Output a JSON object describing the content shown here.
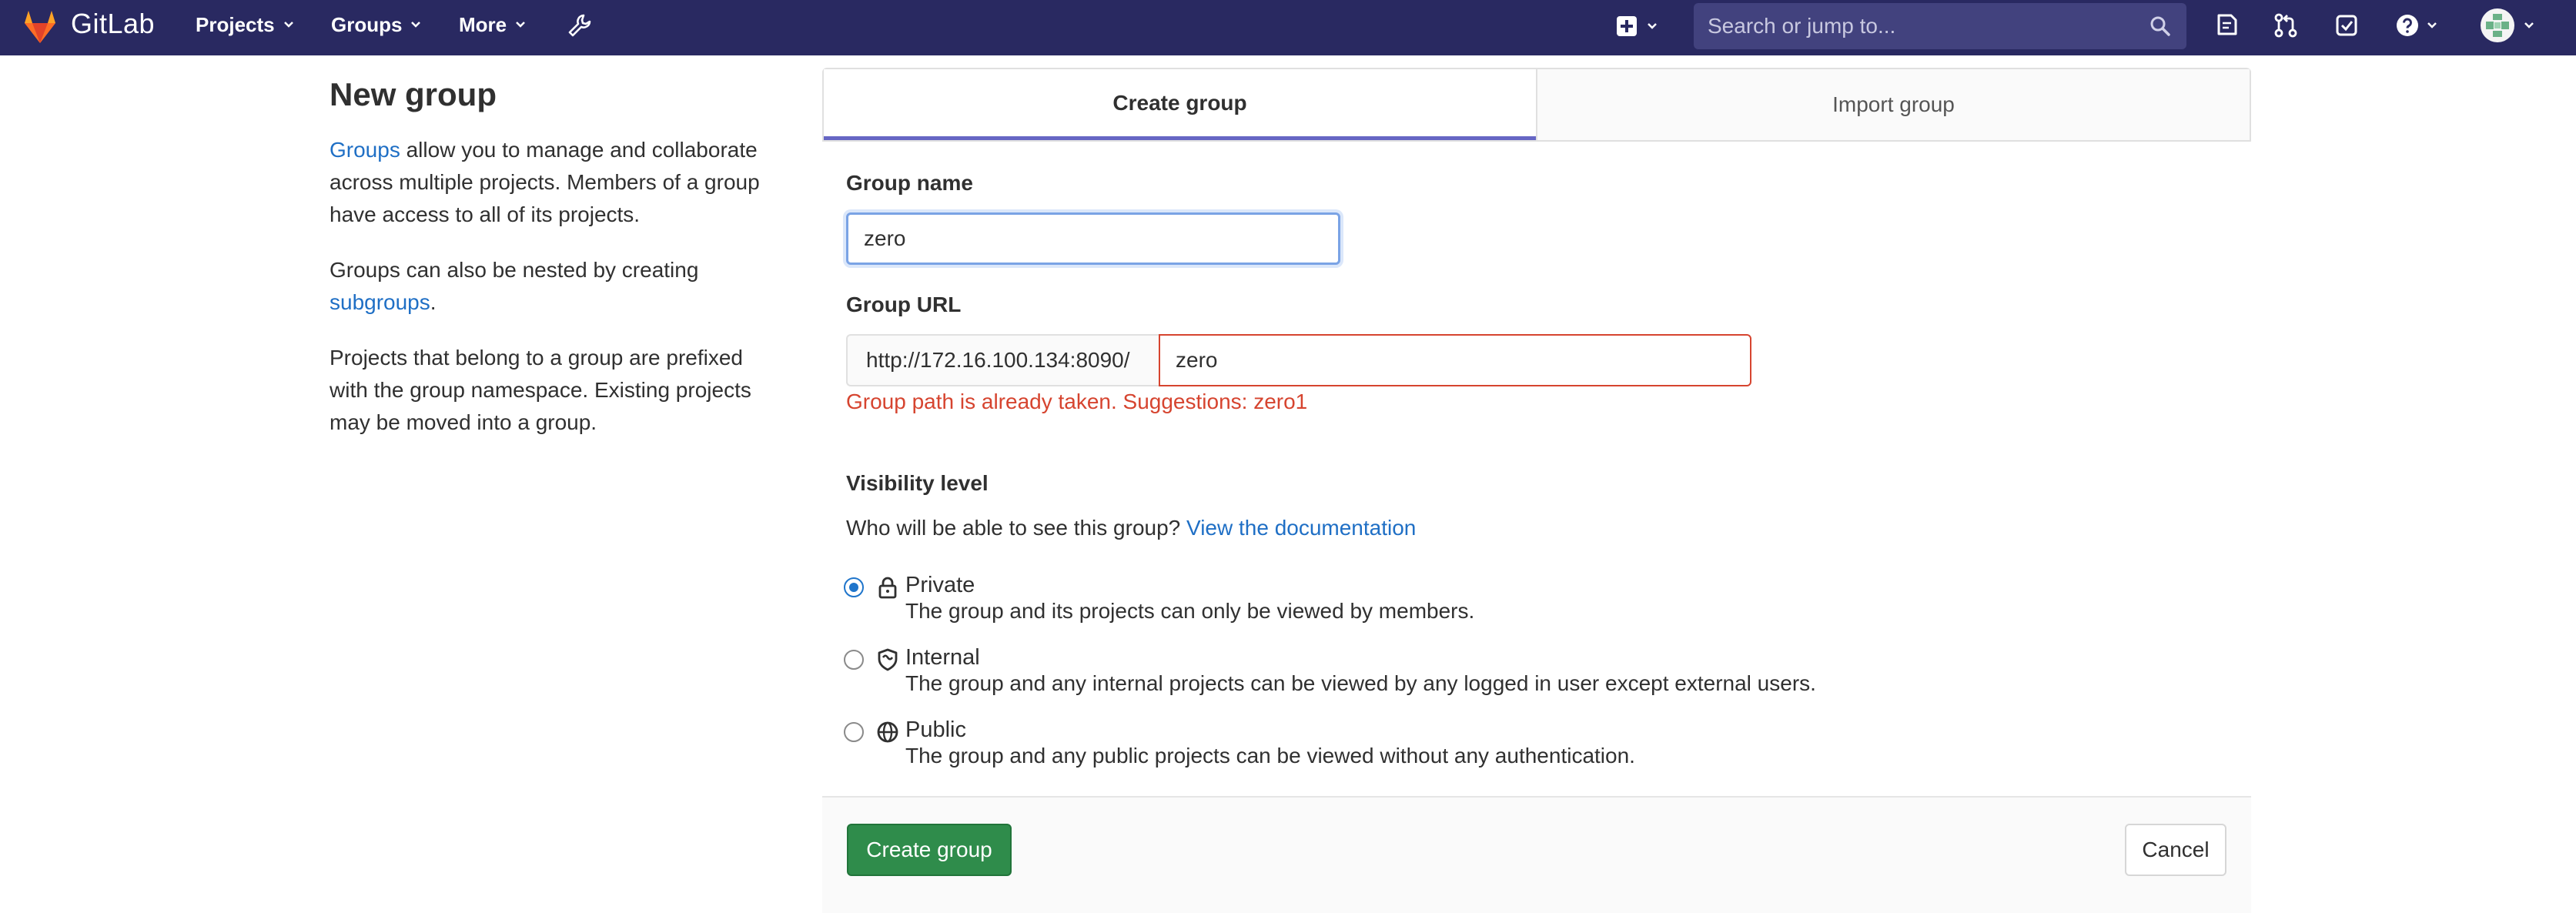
{
  "navbar": {
    "brand": "GitLab",
    "menus": [
      {
        "label": "Projects"
      },
      {
        "label": "Groups"
      },
      {
        "label": "More"
      }
    ],
    "search_placeholder": "Search or jump to...",
    "icons": [
      "gitlab-logo-icon",
      "wrench-icon",
      "plus-square-icon",
      "search-icon",
      "issues-icon",
      "merge-request-icon",
      "todo-icon",
      "help-icon",
      "avatar"
    ]
  },
  "sidebar": {
    "title": "New group",
    "p1_link": "Groups",
    "p1_rest": " allow you to manage and collaborate across multiple projects. Members of a group have access to all of its projects.",
    "p2_text": "Groups can also be nested by creating ",
    "p2_link": "subgroups",
    "p2_end": ".",
    "p3_text": "Projects that belong to a group are prefixed with the group namespace. Existing projects may be moved into a group."
  },
  "tabs": [
    {
      "label": "Create group",
      "active": true
    },
    {
      "label": "Import group",
      "active": false
    }
  ],
  "form": {
    "group_name_label": "Group name",
    "group_name_value": "zero",
    "group_url_label": "Group URL",
    "url_prefix": "http://172.16.100.134:8090/",
    "group_path_value": "zero",
    "error": "Group path is already taken. Suggestions: zero1",
    "visibility_label": "Visibility level",
    "visibility_help": "Who will be able to see this group? ",
    "visibility_help_link": "View the documentation",
    "visibility_options": [
      {
        "title": "Private",
        "desc": "The group and its projects can only be viewed by members.",
        "icon": "lock-icon",
        "selected": true
      },
      {
        "title": "Internal",
        "desc": "The group and any internal projects can be viewed by any logged in user except external users.",
        "icon": "shield-icon",
        "selected": false
      },
      {
        "title": "Public",
        "desc": "The group and any public projects can be viewed without any authentication.",
        "icon": "globe-icon",
        "selected": false
      }
    ]
  },
  "footer": {
    "create_label": "Create group",
    "cancel_label": "Cancel"
  },
  "colors": {
    "navbar": "#292961",
    "link": "#1f6fc5",
    "error": "#d6442f",
    "primary_button": "#2f8c4b",
    "tab_active_underline": "#6666c4"
  }
}
